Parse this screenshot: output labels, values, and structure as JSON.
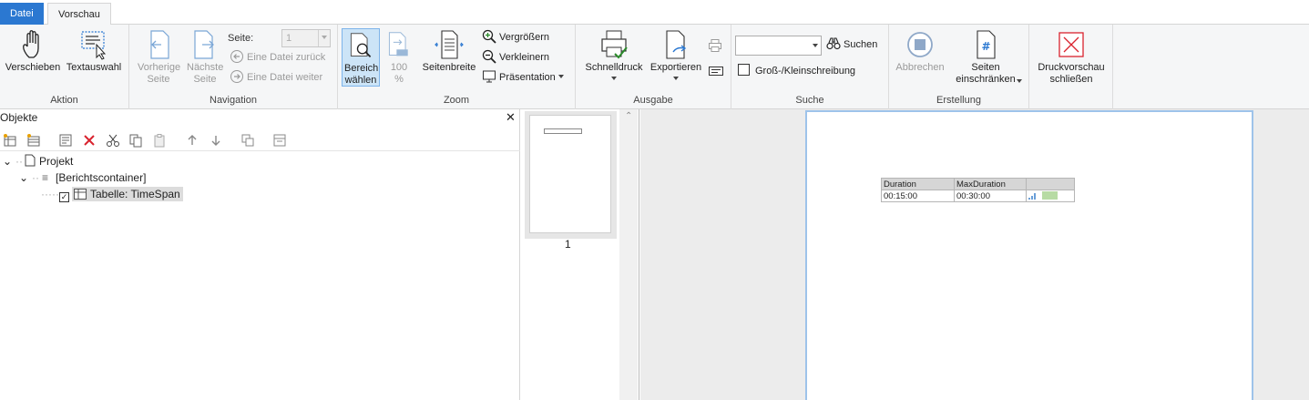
{
  "tabs": {
    "file": "Datei",
    "preview": "Vorschau"
  },
  "ribbon": {
    "aktion": {
      "label": "Aktion",
      "move": "Verschieben",
      "text_select": "Textauswahl"
    },
    "navigation": {
      "label": "Navigation",
      "prev_page": "Vorherige Seite",
      "next_page": "Nächste Seite",
      "page_label": "Seite:",
      "page_value": "1",
      "file_back": "Eine Datei zurück",
      "file_forward": "Eine Datei weiter"
    },
    "zoom": {
      "label": "Zoom",
      "area_select": "Bereich wählen",
      "hundred": "100 %",
      "page_width": "Seitenbreite",
      "zoom_in": "Vergrößern",
      "zoom_out": "Verkleinern",
      "presentation": "Präsentation"
    },
    "ausgabe": {
      "label": "Ausgabe",
      "quick_print": "Schnelldruck",
      "export": "Exportieren"
    },
    "suche": {
      "label": "Suche",
      "search": "Suchen",
      "case": "Groß-/Kleinschreibung",
      "search_value": ""
    },
    "erstellung": {
      "label": "Erstellung",
      "cancel": "Abbrechen",
      "restrict": "Seiten einschränken"
    },
    "close": {
      "label": "Druckvorschau schließen"
    }
  },
  "objects": {
    "title": "Objekte",
    "tree": [
      {
        "label": "Projekt"
      },
      {
        "label": "[Berichtscontainer]"
      },
      {
        "label": "Tabelle: TimeSpan"
      }
    ]
  },
  "thumbnails": {
    "page_number": "1"
  },
  "report": {
    "headers": [
      "Duration",
      "MaxDuration",
      ""
    ],
    "rows": [
      [
        "00:15:00",
        "00:30:00",
        ""
      ]
    ]
  },
  "colors": {
    "accent": "#2b78d1",
    "active_bg": "#cce4f7",
    "close_red": "#d9232e",
    "bar_green": "#b7dba4"
  }
}
